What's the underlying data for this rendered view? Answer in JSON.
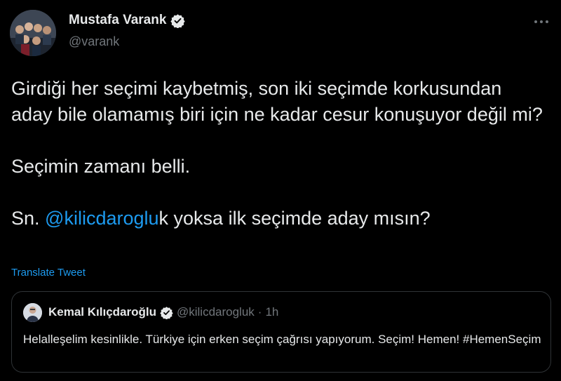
{
  "colors": {
    "background": "#000000",
    "text_primary": "#e7e9ea",
    "text_secondary": "#71767b",
    "link": "#1d9bf0",
    "border": "#2f3336"
  },
  "tweet": {
    "author": {
      "display_name": "Mustafa Varank",
      "handle": "@varank",
      "verified": true,
      "avatar_icon": "group-photo-avatar"
    },
    "more_icon": "more-horizontal-icon",
    "body": {
      "paragraph_1": "Girdiği her seçimi kaybetmiş, son iki seçimde korkusundan aday bile olamamış biri için ne kadar cesur konuşuyor değil mi?",
      "paragraph_2": "Seçimin zamanı belli.",
      "paragraph_3_prefix": "Sn.",
      "paragraph_3_mention": "@kilicdaroglu",
      "paragraph_3_suffix": "k yoksa ilk seçimde aday mısın?"
    },
    "translate_label": "Translate Tweet"
  },
  "quoted_tweet": {
    "display_name": "Kemal Kılıçdaroğlu",
    "verified": true,
    "handle": "@kilicdarogluk",
    "separator": "·",
    "time": "1h",
    "text": "Helalleşelim kesinlikle. Türkiye için erken seçim çağrısı yapıyorum. Seçim! Hemen! #HemenSeçim"
  }
}
